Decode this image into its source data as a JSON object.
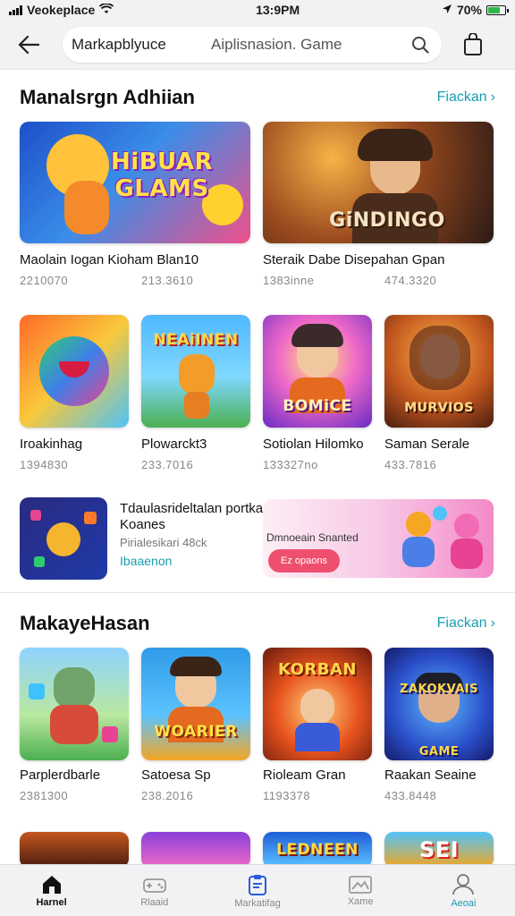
{
  "status_bar": {
    "carrier": "Veokeplace",
    "time": "13:9PM",
    "battery": "70%",
    "battery_level": 0.7
  },
  "header": {
    "search_scope": "Markapblyuce",
    "search_value": "Aiplisnasion. Game"
  },
  "section1": {
    "title": "Manalsrgn Adhiian",
    "see_all": "Fiackan",
    "featured": [
      {
        "art": "HiBUAR GLAMS",
        "name": "Maolain Iogan Kioham Blan10",
        "meta": "2210070"
      },
      {
        "art": "",
        "name": "",
        "meta": "213.3610"
      },
      {
        "art": "GiNDINGO",
        "name": "Steraik Dabe Disepahan Gpan",
        "meta": "1383inne"
      },
      {
        "art": "",
        "name": "",
        "meta": "474.3320"
      }
    ],
    "row": [
      {
        "art": "",
        "name": "Iroakinhag",
        "meta": "1394830"
      },
      {
        "art": "NEAiINEN",
        "name": "Plowarckt3",
        "meta": "233.7016"
      },
      {
        "art": "BOMiCE",
        "name": "Sotiolan Hilomko",
        "meta": "133327no"
      },
      {
        "art": "MURVIOS",
        "name": "Saman Serale",
        "meta": "433.7816"
      }
    ]
  },
  "banner": {
    "main_text": "Tdaulasrideltalan portkanian Koanes",
    "sub_text": "Pirialesikari 48ck",
    "link": "Ibaaenon",
    "promo_label": "Dmnoeain Snanted",
    "promo_button": "Ez opaons"
  },
  "section2": {
    "title": "MakayeHasan",
    "see_all": "Fiackan",
    "row": [
      {
        "art": "",
        "name": "Parplerdbarle",
        "meta": "2381300"
      },
      {
        "art": "WOARIER",
        "name": "Satoesa Sp",
        "meta": "238.2016"
      },
      {
        "art": "KORBAN",
        "name": "Rioleam Gran",
        "meta": "1193378"
      },
      {
        "art": "ZAKOKVAIS GAME",
        "name": "Raakan Seaine",
        "meta": "433.8448"
      }
    ],
    "peek": [
      {
        "art": ""
      },
      {
        "art": ""
      },
      {
        "art": "LEDNEEN"
      },
      {
        "art": "SEI"
      }
    ]
  },
  "bottom_nav": [
    {
      "label": "Harnel",
      "icon": "home-icon"
    },
    {
      "label": "Rlaaid",
      "icon": "games-icon"
    },
    {
      "label": "Markatifag",
      "icon": "marketplace-icon"
    },
    {
      "label": "Xame",
      "icon": "image-icon"
    },
    {
      "label": "Aeoai",
      "icon": "profile-icon"
    }
  ],
  "colors": {
    "accent": "#1a9db0",
    "promo_button": "#ef4f6e",
    "battery": "#2db84a"
  }
}
